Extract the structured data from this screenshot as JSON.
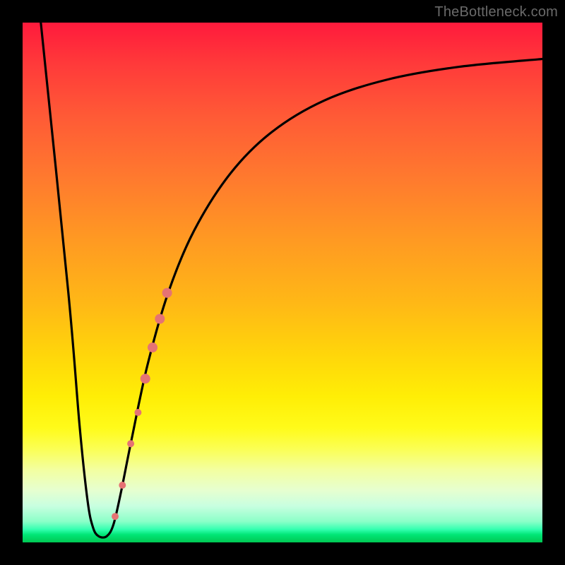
{
  "watermark": "TheBottleneck.com",
  "chart_data": {
    "type": "line",
    "title": "",
    "xlabel": "",
    "ylabel": "",
    "xlim": [
      0,
      100
    ],
    "ylim": [
      0,
      100
    ],
    "curve": {
      "name": "bottleneck-curve",
      "color": "#000000",
      "points": [
        {
          "x": 3.5,
          "y": 100
        },
        {
          "x": 8.8,
          "y": 48
        },
        {
          "x": 11.0,
          "y": 22
        },
        {
          "x": 12.5,
          "y": 8
        },
        {
          "x": 13.5,
          "y": 3
        },
        {
          "x": 14.6,
          "y": 1.2
        },
        {
          "x": 16.2,
          "y": 1.2
        },
        {
          "x": 17.5,
          "y": 3.5
        },
        {
          "x": 19.0,
          "y": 10
        },
        {
          "x": 21.0,
          "y": 20
        },
        {
          "x": 24.0,
          "y": 34
        },
        {
          "x": 28.0,
          "y": 48
        },
        {
          "x": 33.0,
          "y": 60
        },
        {
          "x": 40.0,
          "y": 71
        },
        {
          "x": 48.0,
          "y": 79
        },
        {
          "x": 58.0,
          "y": 85
        },
        {
          "x": 70.0,
          "y": 89
        },
        {
          "x": 84.0,
          "y": 91.5
        },
        {
          "x": 100.0,
          "y": 93
        }
      ]
    },
    "markers": {
      "name": "highlight-segment",
      "color": "#e57373",
      "items": [
        {
          "x": 17.8,
          "y": 5,
          "r": 5
        },
        {
          "x": 19.2,
          "y": 11,
          "r": 5
        },
        {
          "x": 20.8,
          "y": 19,
          "r": 5
        },
        {
          "x": 22.2,
          "y": 25,
          "r": 5
        },
        {
          "x": 23.6,
          "y": 31.5,
          "r": 7
        },
        {
          "x": 25.0,
          "y": 37.5,
          "r": 7
        },
        {
          "x": 26.4,
          "y": 43,
          "r": 7
        },
        {
          "x": 27.8,
          "y": 48,
          "r": 7
        }
      ]
    },
    "background_gradient": {
      "top": "#ff1a3c",
      "middle": "#ffd60a",
      "bottom": "#00c853"
    }
  }
}
